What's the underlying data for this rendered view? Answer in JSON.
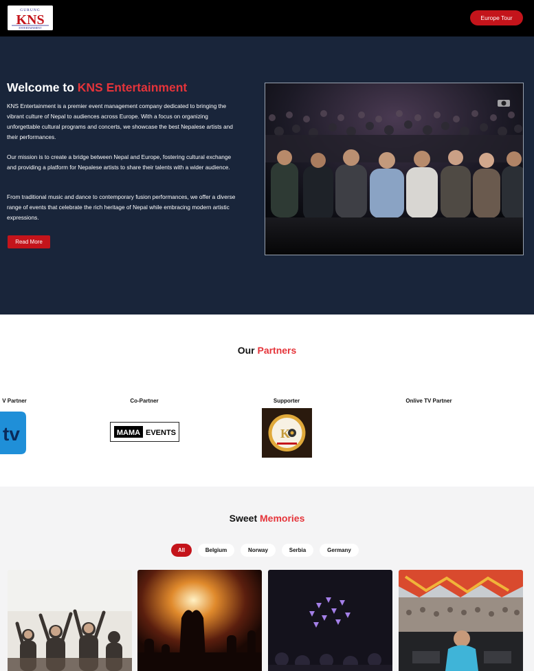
{
  "header": {
    "logo": {
      "top_text": "GURUNG",
      "main_text": "KNS",
      "bottom_text": "ENTERTAINMENT"
    },
    "tour_button": "Europe Tour"
  },
  "hero": {
    "title_prefix": "Welcome to ",
    "title_accent": "KNS Entertainment",
    "paragraphs": [
      "KNS Entertainment is a premier event management company dedicated to bringing the vibrant culture of Nepal to audiences across Europe. With a focus on organizing unforgettable cultural programs and concerts, we showcase the best Nepalese artists and their performances.",
      "Our mission is to create a bridge between Nepal and Europe, fostering cultural exchange and providing a platform for Nepalese artists to share their talents with a wider audience.",
      "From traditional music and dance to contemporary fusion performances, we offer a diverse range of events that celebrate the rich heritage of Nepal while embracing modern artistic expressions."
    ],
    "read_more": "Read More"
  },
  "partners": {
    "title_prefix": "Our ",
    "title_accent": "Partners",
    "items": [
      {
        "label": "V Partner",
        "logo": "tv-logo"
      },
      {
        "label": "Co-Partner",
        "logo": "mama-events-logo",
        "logo_text_a": "MAMA",
        "logo_text_b": "EVENTS"
      },
      {
        "label": "Supporter",
        "logo": "ko-logo"
      },
      {
        "label": "Onlive TV Partner",
        "logo": ""
      }
    ]
  },
  "memories": {
    "title_prefix": "Sweet ",
    "title_accent": "Memories",
    "filters": [
      "All",
      "Belgium",
      "Norway",
      "Serbia",
      "Germany"
    ],
    "active_filter": "All",
    "cards": [
      "crowd-photo",
      "concert-hands-photo",
      "light-show-photo",
      "dj-festival-photo"
    ]
  },
  "colors": {
    "accent": "#c4141b",
    "accent_text": "#e5343a",
    "hero_bg": "#19253a",
    "header_bg": "#000000",
    "memories_bg": "#f4f4f5"
  }
}
